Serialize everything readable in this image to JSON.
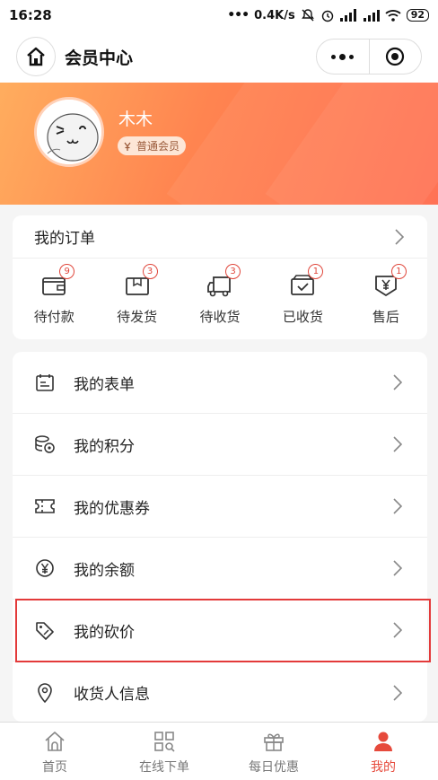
{
  "status_bar": {
    "time": "16:28",
    "speed": "0.4K/s",
    "battery": "92"
  },
  "header": {
    "title": "会员中心"
  },
  "profile": {
    "name": "木木",
    "level": "普通会员"
  },
  "orders": {
    "title": "我的订单",
    "items": [
      {
        "label": "待付款",
        "count": "9",
        "icon": "wallet-icon"
      },
      {
        "label": "待发货",
        "count": "3",
        "icon": "package-icon"
      },
      {
        "label": "待收货",
        "count": "3",
        "icon": "truck-icon"
      },
      {
        "label": "已收货",
        "count": "1",
        "icon": "box-check-icon"
      },
      {
        "label": "售后",
        "count": "1",
        "icon": "yen-shield-icon"
      }
    ]
  },
  "menu": {
    "items": [
      {
        "label": "我的表单",
        "icon": "form-icon"
      },
      {
        "label": "我的积分",
        "icon": "coins-icon"
      },
      {
        "label": "我的优惠券",
        "icon": "ticket-icon"
      },
      {
        "label": "我的余额",
        "icon": "yen-circle-icon"
      },
      {
        "label": "我的砍价",
        "icon": "tag-icon"
      },
      {
        "label": "收货人信息",
        "icon": "location-icon"
      }
    ]
  },
  "tabbar": {
    "items": [
      {
        "label": "首页",
        "icon": "home-icon"
      },
      {
        "label": "在线下单",
        "icon": "grid-search-icon"
      },
      {
        "label": "每日优惠",
        "icon": "gift-icon"
      },
      {
        "label": "我的",
        "icon": "user-icon",
        "active": true
      }
    ]
  },
  "colors": {
    "accent": "#e64a3c",
    "header_start": "#ffad5e",
    "header_end": "#ff6a4b",
    "highlight": "#e33a3a"
  }
}
